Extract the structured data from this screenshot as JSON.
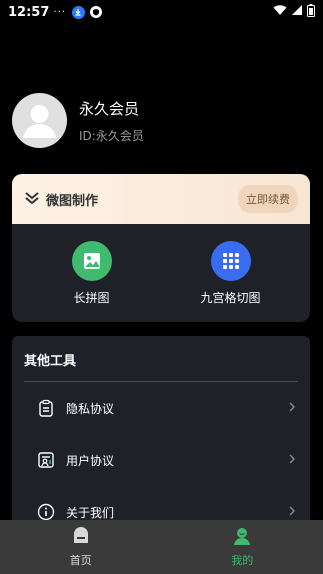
{
  "status_bar": {
    "time": "12:57",
    "dots": "···"
  },
  "profile": {
    "name": "永久会员",
    "id_text": "ID:永久会员"
  },
  "vip_card": {
    "title": "微图制作",
    "renew_label": "立即续费",
    "tools": [
      {
        "label": "长拼图",
        "icon": "image-icon",
        "color": "#3fba6f"
      },
      {
        "label": "九宫格切图",
        "icon": "grid-icon",
        "color": "#3a6cf0"
      }
    ]
  },
  "other_tools": {
    "title": "其他工具",
    "items": [
      {
        "label": "隐私协议",
        "icon": "clipboard-icon"
      },
      {
        "label": "用户协议",
        "icon": "user-card-icon"
      },
      {
        "label": "关于我们",
        "icon": "info-icon"
      }
    ]
  },
  "tab_bar": {
    "tabs": [
      {
        "label": "首页",
        "icon": "home-icon",
        "color": "#d9d9d9"
      },
      {
        "label": "我的",
        "icon": "person-icon",
        "color": "#3fba6f"
      }
    ]
  }
}
